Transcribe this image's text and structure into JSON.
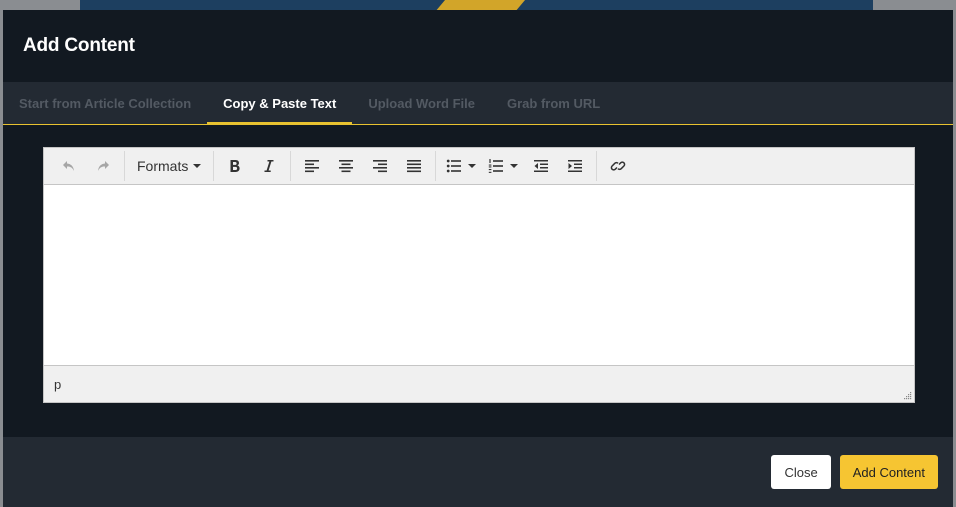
{
  "modal": {
    "title": "Add Content"
  },
  "tabs": [
    {
      "label": "Start from Article Collection",
      "active": false
    },
    {
      "label": "Copy & Paste Text",
      "active": true
    },
    {
      "label": "Upload Word File",
      "active": false
    },
    {
      "label": "Grab from URL",
      "active": false
    }
  ],
  "toolbar": {
    "formats_label": "Formats",
    "icons": [
      "undo-icon",
      "redo-icon",
      "bold-icon",
      "italic-icon",
      "align-left-icon",
      "align-center-icon",
      "align-right-icon",
      "align-justify-icon",
      "bullet-list-icon",
      "numbered-list-icon",
      "outdent-icon",
      "indent-icon",
      "link-icon"
    ]
  },
  "statusbar": {
    "path": "p"
  },
  "footer": {
    "close_label": "Close",
    "add_label": "Add Content"
  },
  "colors": {
    "accent": "#f6c532",
    "modal_bg": "#121921",
    "tab_bar_bg": "#232a33"
  }
}
